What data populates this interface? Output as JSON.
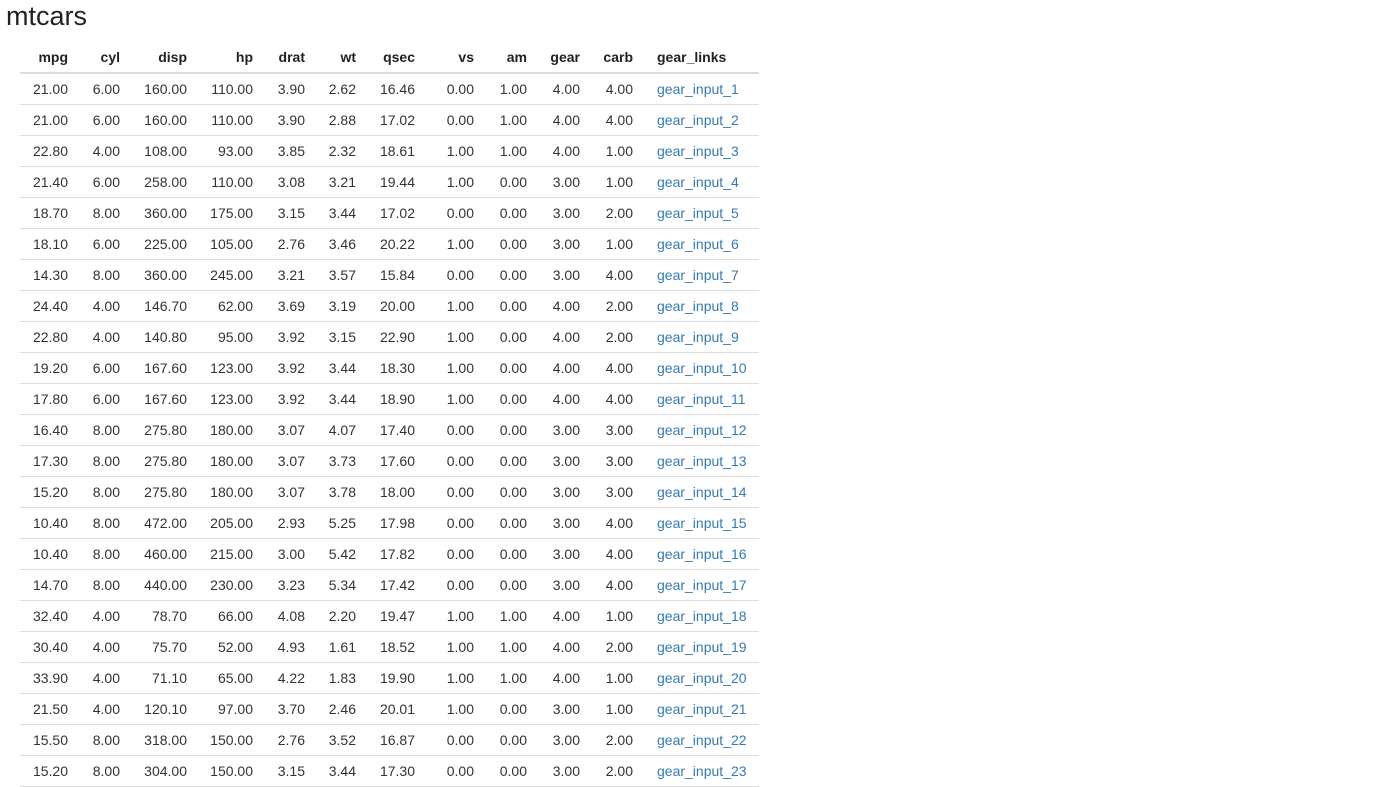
{
  "page": {
    "title": "mtcars"
  },
  "table": {
    "columns": [
      "mpg",
      "cyl",
      "disp",
      "hp",
      "drat",
      "wt",
      "qsec",
      "vs",
      "am",
      "gear",
      "carb",
      "gear_links"
    ],
    "rows": [
      [
        "21.00",
        "6.00",
        "160.00",
        "110.00",
        "3.90",
        "2.62",
        "16.46",
        "0.00",
        "1.00",
        "4.00",
        "4.00",
        "gear_input_1"
      ],
      [
        "21.00",
        "6.00",
        "160.00",
        "110.00",
        "3.90",
        "2.88",
        "17.02",
        "0.00",
        "1.00",
        "4.00",
        "4.00",
        "gear_input_2"
      ],
      [
        "22.80",
        "4.00",
        "108.00",
        "93.00",
        "3.85",
        "2.32",
        "18.61",
        "1.00",
        "1.00",
        "4.00",
        "1.00",
        "gear_input_3"
      ],
      [
        "21.40",
        "6.00",
        "258.00",
        "110.00",
        "3.08",
        "3.21",
        "19.44",
        "1.00",
        "0.00",
        "3.00",
        "1.00",
        "gear_input_4"
      ],
      [
        "18.70",
        "8.00",
        "360.00",
        "175.00",
        "3.15",
        "3.44",
        "17.02",
        "0.00",
        "0.00",
        "3.00",
        "2.00",
        "gear_input_5"
      ],
      [
        "18.10",
        "6.00",
        "225.00",
        "105.00",
        "2.76",
        "3.46",
        "20.22",
        "1.00",
        "0.00",
        "3.00",
        "1.00",
        "gear_input_6"
      ],
      [
        "14.30",
        "8.00",
        "360.00",
        "245.00",
        "3.21",
        "3.57",
        "15.84",
        "0.00",
        "0.00",
        "3.00",
        "4.00",
        "gear_input_7"
      ],
      [
        "24.40",
        "4.00",
        "146.70",
        "62.00",
        "3.69",
        "3.19",
        "20.00",
        "1.00",
        "0.00",
        "4.00",
        "2.00",
        "gear_input_8"
      ],
      [
        "22.80",
        "4.00",
        "140.80",
        "95.00",
        "3.92",
        "3.15",
        "22.90",
        "1.00",
        "0.00",
        "4.00",
        "2.00",
        "gear_input_9"
      ],
      [
        "19.20",
        "6.00",
        "167.60",
        "123.00",
        "3.92",
        "3.44",
        "18.30",
        "1.00",
        "0.00",
        "4.00",
        "4.00",
        "gear_input_10"
      ],
      [
        "17.80",
        "6.00",
        "167.60",
        "123.00",
        "3.92",
        "3.44",
        "18.90",
        "1.00",
        "0.00",
        "4.00",
        "4.00",
        "gear_input_11"
      ],
      [
        "16.40",
        "8.00",
        "275.80",
        "180.00",
        "3.07",
        "4.07",
        "17.40",
        "0.00",
        "0.00",
        "3.00",
        "3.00",
        "gear_input_12"
      ],
      [
        "17.30",
        "8.00",
        "275.80",
        "180.00",
        "3.07",
        "3.73",
        "17.60",
        "0.00",
        "0.00",
        "3.00",
        "3.00",
        "gear_input_13"
      ],
      [
        "15.20",
        "8.00",
        "275.80",
        "180.00",
        "3.07",
        "3.78",
        "18.00",
        "0.00",
        "0.00",
        "3.00",
        "3.00",
        "gear_input_14"
      ],
      [
        "10.40",
        "8.00",
        "472.00",
        "205.00",
        "2.93",
        "5.25",
        "17.98",
        "0.00",
        "0.00",
        "3.00",
        "4.00",
        "gear_input_15"
      ],
      [
        "10.40",
        "8.00",
        "460.00",
        "215.00",
        "3.00",
        "5.42",
        "17.82",
        "0.00",
        "0.00",
        "3.00",
        "4.00",
        "gear_input_16"
      ],
      [
        "14.70",
        "8.00",
        "440.00",
        "230.00",
        "3.23",
        "5.34",
        "17.42",
        "0.00",
        "0.00",
        "3.00",
        "4.00",
        "gear_input_17"
      ],
      [
        "32.40",
        "4.00",
        "78.70",
        "66.00",
        "4.08",
        "2.20",
        "19.47",
        "1.00",
        "1.00",
        "4.00",
        "1.00",
        "gear_input_18"
      ],
      [
        "30.40",
        "4.00",
        "75.70",
        "52.00",
        "4.93",
        "1.61",
        "18.52",
        "1.00",
        "1.00",
        "4.00",
        "2.00",
        "gear_input_19"
      ],
      [
        "33.90",
        "4.00",
        "71.10",
        "65.00",
        "4.22",
        "1.83",
        "19.90",
        "1.00",
        "1.00",
        "4.00",
        "1.00",
        "gear_input_20"
      ],
      [
        "21.50",
        "4.00",
        "120.10",
        "97.00",
        "3.70",
        "2.46",
        "20.01",
        "1.00",
        "0.00",
        "3.00",
        "1.00",
        "gear_input_21"
      ],
      [
        "15.50",
        "8.00",
        "318.00",
        "150.00",
        "2.76",
        "3.52",
        "16.87",
        "0.00",
        "0.00",
        "3.00",
        "2.00",
        "gear_input_22"
      ],
      [
        "15.20",
        "8.00",
        "304.00",
        "150.00",
        "3.15",
        "3.44",
        "17.30",
        "0.00",
        "0.00",
        "3.00",
        "2.00",
        "gear_input_23"
      ]
    ]
  },
  "colors": {
    "link": "#337ab7",
    "border": "#dddddd",
    "text": "#333333"
  }
}
